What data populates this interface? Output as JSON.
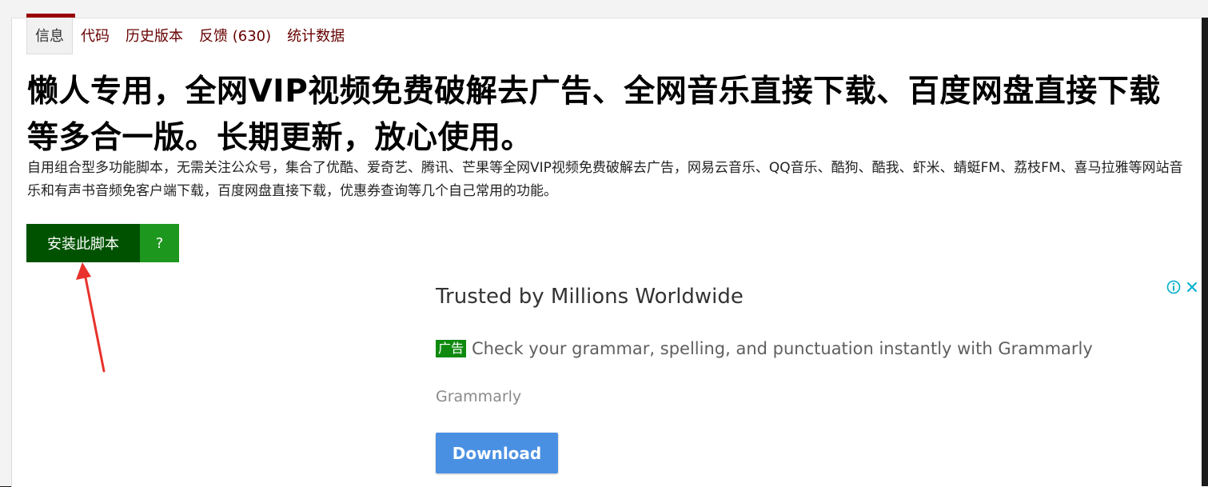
{
  "tabs": [
    {
      "label": "信息"
    },
    {
      "label": "代码"
    },
    {
      "label": "历史版本"
    },
    {
      "label": "反馈 (630)"
    },
    {
      "label": "统计数据"
    }
  ],
  "script": {
    "title": "懒人专用，全网VIP视频免费破解去广告、全网音乐直接下载、百度网盘直接下载等多合一版。长期更新，放心使用。",
    "description": "自用组合型多功能脚本，无需关注公众号，集合了优酷、爱奇艺、腾讯、芒果等全网VIP视频免费破解去广告，网易云音乐、QQ音乐、酷狗、酷我、虾米、蜻蜓FM、荔枝FM、喜马拉雅等网站音乐和有声书音频免客户端下载，百度网盘直接下载，优惠券查询等几个自己常用的功能。",
    "install_label": "安装此脚本",
    "help_label": "?"
  },
  "ad": {
    "headline": "Trusted by Millions Worldwide",
    "badge": "广告",
    "body": "Check your grammar, spelling, and punctuation instantly with Grammarly",
    "brand": "Grammarly",
    "button": "Download"
  },
  "colors": {
    "tab_text": "#670000",
    "accent": "#990000",
    "install_bg": "#005200",
    "help_bg": "#1e971e",
    "ad_badge": "#0f8a0f",
    "ad_button": "#4a90e2",
    "annotation_arrow": "#e8322b"
  },
  "icons": {
    "ad_info": "info-icon",
    "ad_close": "close-icon",
    "annotation": "red-arrow-annotation"
  }
}
